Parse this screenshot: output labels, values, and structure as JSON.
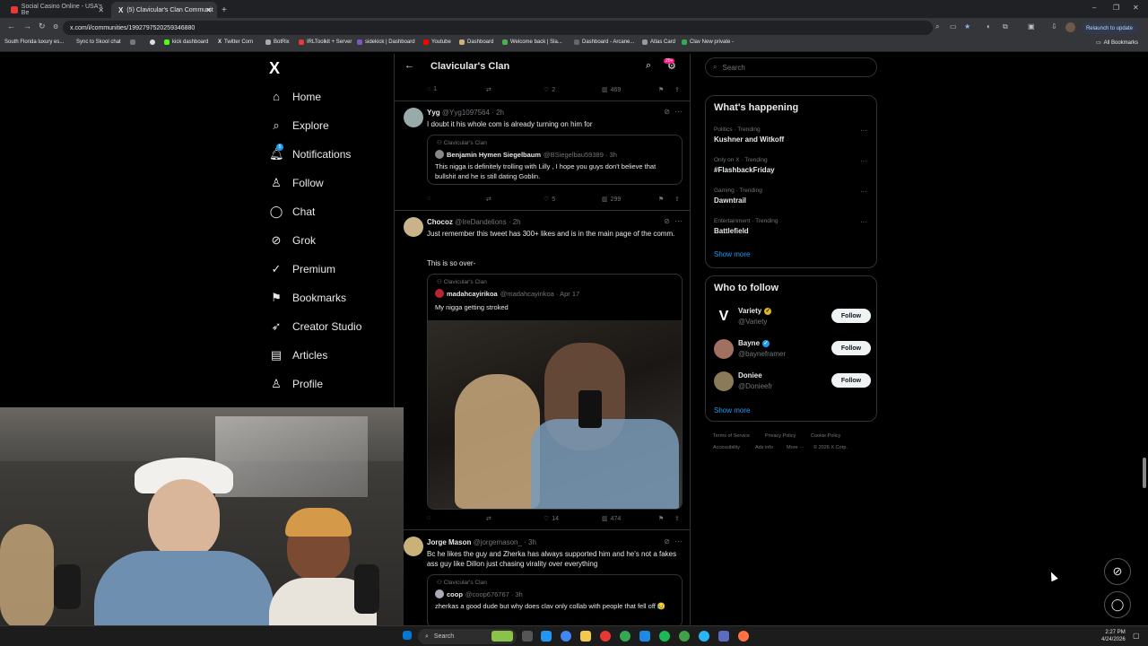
{
  "browser": {
    "tabs": [
      {
        "label": "Social Casino Online - USA's Be"
      },
      {
        "label": "(5) Clavicular's Clan Communit"
      }
    ],
    "url": "x.com/i/communities/1992797520259346880",
    "relaunch_label": "Relaunch to update",
    "bookmarks": [
      "South Florida luxury es...",
      "Sync to Skool chat",
      "kick dashboard",
      "Twitter Com",
      "BotRix",
      "IRLToolkit + Server",
      "sidekick | Dashboard",
      "Youtube",
      "Dashboard",
      "Welcome back | Sla...",
      "Dashboard - Arcane...",
      "Atlas Card",
      "Clav New private -"
    ],
    "all_bookmarks": "All Bookmarks"
  },
  "nav": {
    "logo": "X",
    "items": [
      {
        "label": "Home",
        "icon": "home-icon",
        "glyph": "⌂"
      },
      {
        "label": "Explore",
        "icon": "search-icon",
        "glyph": "⌕"
      },
      {
        "label": "Notifications",
        "icon": "bell-icon",
        "glyph": "♫"
      },
      {
        "label": "Follow",
        "icon": "follow-icon",
        "glyph": "♙"
      },
      {
        "label": "Chat",
        "icon": "chat-icon",
        "glyph": "◯"
      },
      {
        "label": "Grok",
        "icon": "grok-icon",
        "glyph": "⊘"
      },
      {
        "label": "Premium",
        "icon": "premium-icon",
        "glyph": "✓"
      },
      {
        "label": "Bookmarks",
        "icon": "bookmark-icon",
        "glyph": "⚑"
      },
      {
        "label": "Creator Studio",
        "icon": "rocket-icon",
        "glyph": "➶"
      },
      {
        "label": "Articles",
        "icon": "article-icon",
        "glyph": "▤"
      },
      {
        "label": "Profile",
        "icon": "profile-icon",
        "glyph": "♙"
      }
    ],
    "notification_badge": "5"
  },
  "feed": {
    "title": "Clavicular's Clan",
    "badge": "20+",
    "top_actions": {
      "replies": "1",
      "likes": "2",
      "views": "469"
    },
    "tweets": [
      {
        "name": "Yyg",
        "handle": "@Yyg1097564 · 2h",
        "text": "I doubt it his whole com is already turning on him for",
        "quote": {
          "community": "Clavicular's Clan",
          "name": "Benjamin Hymen Siegelbaum",
          "handle": "@BSiegelbau59389 · 3h",
          "text": "This nigga is definitely trolling with Lilly , I hope you guys don't believe that bullshit and he is still dating Goblin."
        },
        "actions": {
          "replies": "",
          "likes": "5",
          "views": "299"
        }
      },
      {
        "name": "Chocoz",
        "handle": "@IreDandelions · 2h",
        "text": "Just remember this tweet has 300+ likes and is in the main page of the comm.",
        "text2": "This is so over-",
        "quote": {
          "community": "Clavicular's Clan",
          "name": "madahcayirikoa",
          "handle": "@madahcayirikoa · Apr 17",
          "text": "My nigga getting stroked"
        },
        "actions": {
          "replies": "",
          "likes": "14",
          "views": "474"
        }
      },
      {
        "name": "Jorge Mason",
        "handle": "@jorgemason_ · 3h",
        "text": "Bc he likes the guy and Zherka has always supported him and he's not a fakes ass guy like Dillon just chasing virality over everything",
        "quote": {
          "community": "Clavicular's Clan",
          "name": "coop",
          "handle": "@coop676767 · 3h",
          "text": "zherkas a good dude but why does clav only collab with people that fell off 😥"
        }
      }
    ]
  },
  "sidebar": {
    "search_placeholder": "Search",
    "happening_title": "What's happening",
    "trends": [
      {
        "meta": "Politics · Trending",
        "topic": "Kushner and Witkoff"
      },
      {
        "meta": "Only on X · Trending",
        "topic": "#FlashbackFriday"
      },
      {
        "meta": "Gaming · Trending",
        "topic": "Dawntrail"
      },
      {
        "meta": "Entertainment · Trending",
        "topic": "Battlefield"
      }
    ],
    "show_more": "Show more",
    "follow_title": "Who to follow",
    "suggestions": [
      {
        "name": "Variety",
        "handle": "@Variety",
        "verified": "gold",
        "follow_label": "Follow"
      },
      {
        "name": "Bayne",
        "handle": "@bayneframer",
        "verified": "blue",
        "follow_label": "Follow"
      },
      {
        "name": "Doniee",
        "handle": "@Donieefr",
        "verified": "",
        "follow_label": "Follow"
      }
    ],
    "show_more2": "Show more",
    "footer_links": [
      "Terms of Service",
      "Privacy Policy",
      "Cookie Policy",
      "Accessibility",
      "Ads info",
      "More ···",
      "© 2026 X Corp."
    ]
  },
  "taskbar": {
    "search_label": "Search",
    "time": "2:27 PM",
    "date": "4/24/2026"
  },
  "colors": {
    "accent": "#1d9bf0",
    "badge": "#f91880",
    "gold": "#e2b719"
  }
}
